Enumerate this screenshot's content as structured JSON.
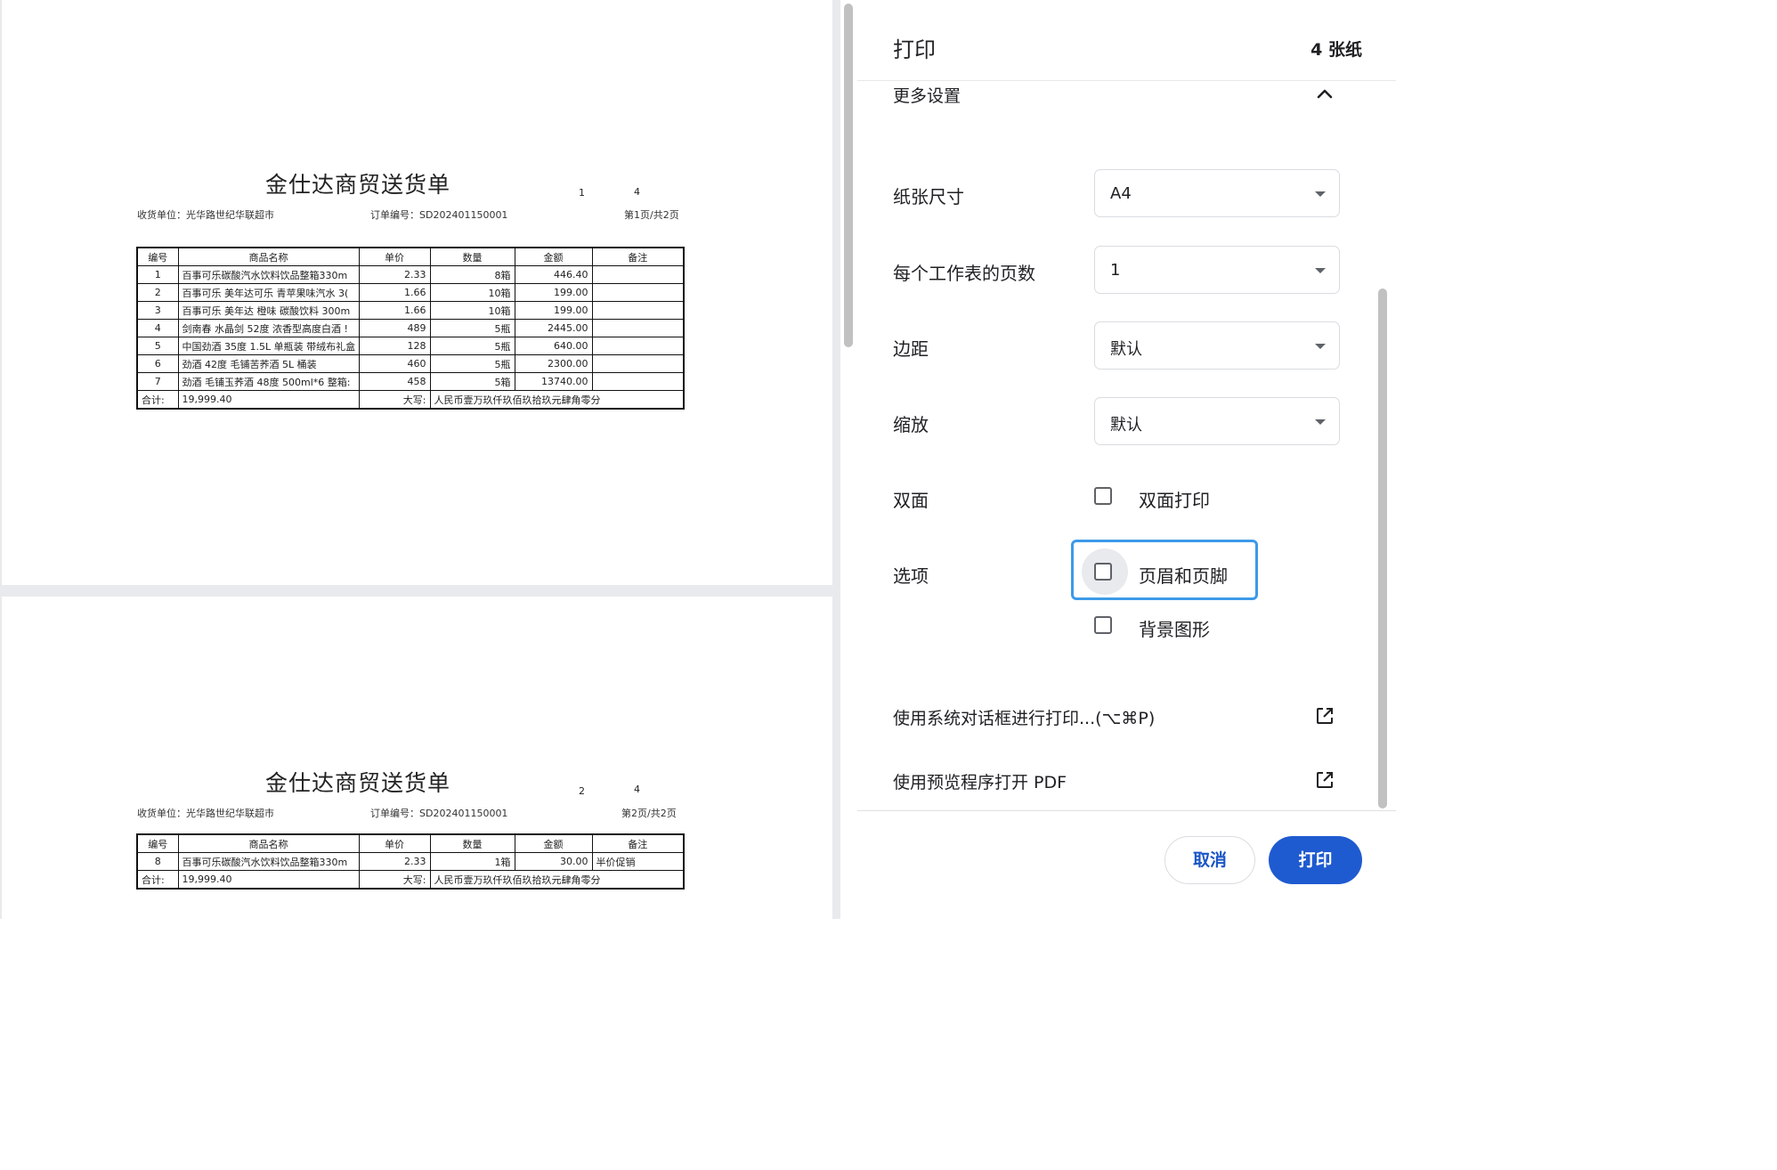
{
  "preview": {
    "pages": [
      {
        "title": "金仕达商贸送货单",
        "header_nums": [
          "1",
          "4"
        ],
        "consignee": "收货单位：光华路世纪华联超市",
        "order_no": "订单编号：SD202401150001",
        "page_info": "第1页/共2页",
        "columns": [
          "编号",
          "商品名称",
          "单价",
          "数量",
          "金额",
          "备注"
        ],
        "rows": [
          [
            "1",
            "百事可乐碳酸汽水饮料饮品整箱330m",
            "2.33",
            "8箱",
            "446.40",
            ""
          ],
          [
            "2",
            "百事可乐 美年达可乐 青苹果味汽水 3(",
            "1.66",
            "10箱",
            "199.00",
            ""
          ],
          [
            "3",
            "百事可乐 美年达 橙味 碳酸饮料 300m",
            "1.66",
            "10箱",
            "199.00",
            ""
          ],
          [
            "4",
            "剑南春 水晶剑 52度 浓香型高度白酒 !",
            "489",
            "5瓶",
            "2445.00",
            ""
          ],
          [
            "5",
            "中国劲酒 35度 1.5L 单瓶装 带绒布礼盒",
            "128",
            "5瓶",
            "640.00",
            ""
          ],
          [
            "6",
            "劲酒 42度 毛铺苦荞酒 5L 桶装",
            "460",
            "5瓶",
            "2300.00",
            ""
          ],
          [
            "7",
            "劲酒 毛铺玉荞酒 48度 500ml*6 整箱:",
            "458",
            "5箱",
            "13740.00",
            ""
          ]
        ],
        "total_label": "合计:",
        "total_value": "19,999.40",
        "capital_label": "大写:",
        "capital_value": "人民币壹万玖仟玖佰玖拾玖元肆角零分"
      },
      {
        "title": "金仕达商贸送货单",
        "header_nums": [
          "2",
          "4"
        ],
        "consignee": "收货单位：光华路世纪华联超市",
        "order_no": "订单编号：SD202401150001",
        "page_info": "第2页/共2页",
        "columns": [
          "编号",
          "商品名称",
          "单价",
          "数量",
          "金额",
          "备注"
        ],
        "rows": [
          [
            "8",
            "百事可乐碳酸汽水饮料饮品整箱330m",
            "2.33",
            "1箱",
            "30.00",
            "半价促销"
          ]
        ],
        "total_label": "合计:",
        "total_value": "19,999.40",
        "capital_label": "大写:",
        "capital_value": "人民币壹万玖仟玖佰玖拾玖元肆角零分"
      }
    ]
  },
  "sidebar": {
    "title": "打印",
    "sheet_count": "4 张纸",
    "more_settings": "更多设置",
    "settings": [
      {
        "label": "纸张尺寸",
        "value": "A4"
      },
      {
        "label": "每个工作表的页数",
        "value": "1"
      },
      {
        "label": "边距",
        "value": "默认"
      },
      {
        "label": "缩放",
        "value": "默认"
      }
    ],
    "duplex": {
      "label": "双面",
      "option": "双面打印",
      "checked": false
    },
    "options": {
      "label": "选项",
      "header_footer": {
        "label": "页眉和页脚",
        "checked": false
      },
      "background": {
        "label": "背景图形",
        "checked": false
      }
    },
    "links": [
      {
        "label": "使用系统对话框进行打印...(⌥⌘P)",
        "icon": "open-external-icon"
      },
      {
        "label": "使用预览程序打开 PDF",
        "icon": "open-external-icon"
      }
    ]
  },
  "footer": {
    "cancel_label": "取消",
    "print_label": "打印",
    "accent": "#1f5bd0"
  }
}
